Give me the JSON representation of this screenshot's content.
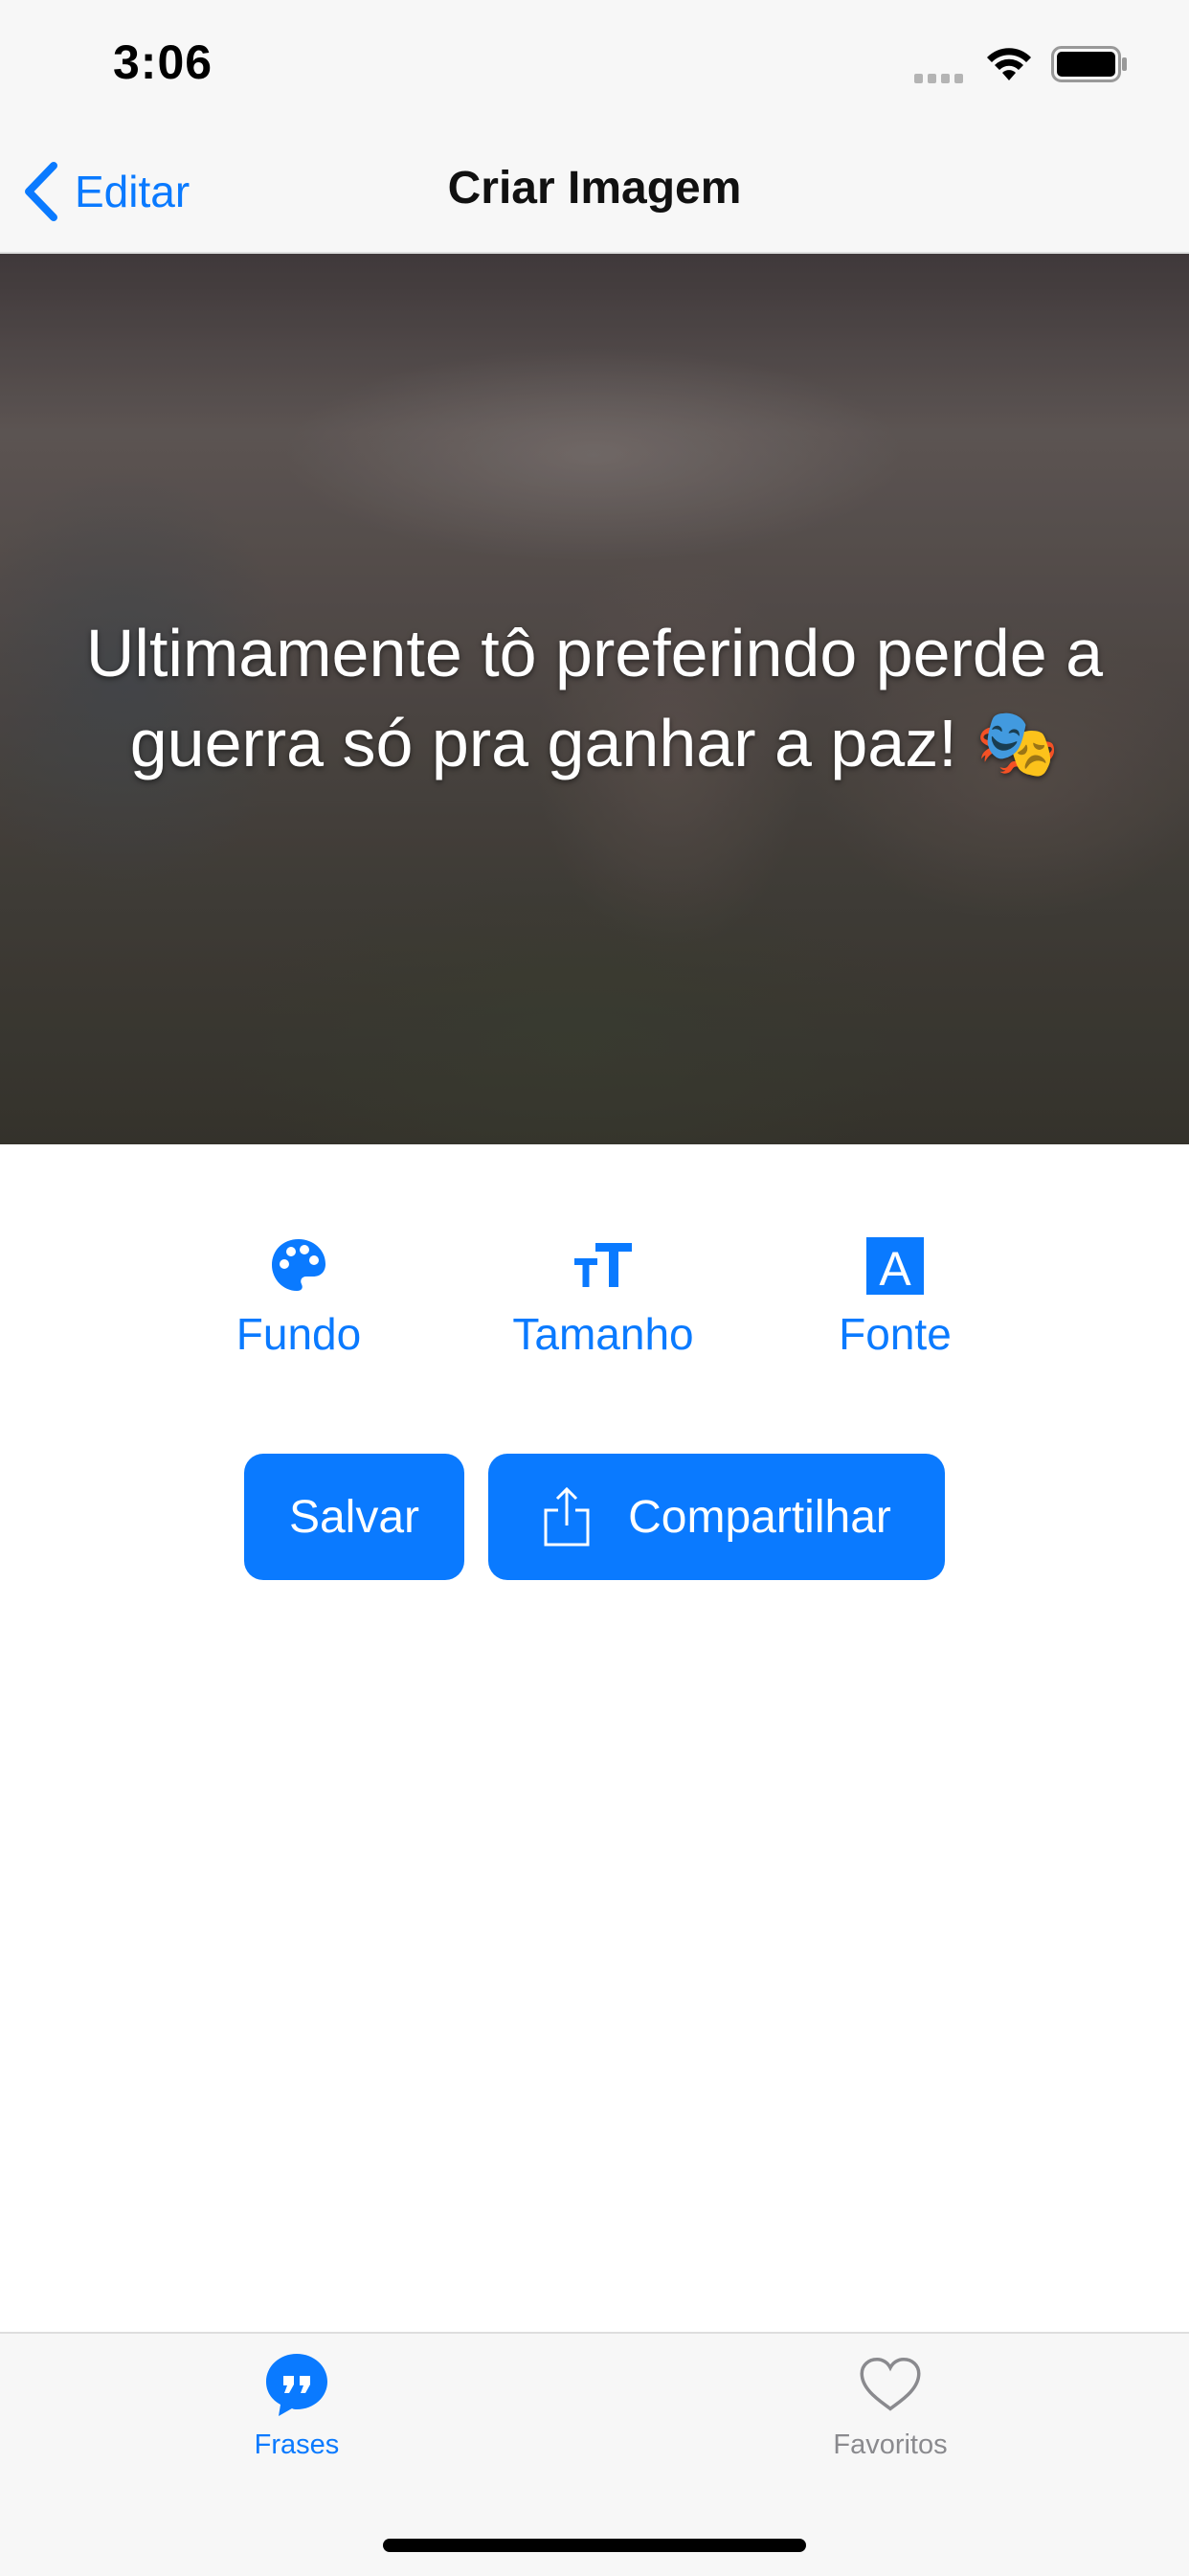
{
  "status_bar": {
    "time": "3:06"
  },
  "nav": {
    "back_label": "Editar",
    "title": "Criar Imagem"
  },
  "preview": {
    "quote_line1": "Ultimamente tô preferindo perde a",
    "quote_line2": "guerra só pra ganhar a paz! 🎭"
  },
  "tools": [
    {
      "label": "Fundo",
      "icon": "palette-icon"
    },
    {
      "label": "Tamanho",
      "icon": "text-size-icon"
    },
    {
      "label": "Fonte",
      "icon": "font-icon",
      "glyph": "A"
    }
  ],
  "actions": {
    "save_label": "Salvar",
    "share_label": "Compartilhar"
  },
  "tab_bar": {
    "items": [
      {
        "label": "Frases",
        "icon": "quote-bubble-icon",
        "selected": true
      },
      {
        "label": "Favoritos",
        "icon": "heart-icon",
        "selected": false
      }
    ]
  },
  "colors": {
    "accent": "#0a7aff",
    "inactive": "#8a8a8e",
    "bar_background": "#f7f7f7"
  }
}
